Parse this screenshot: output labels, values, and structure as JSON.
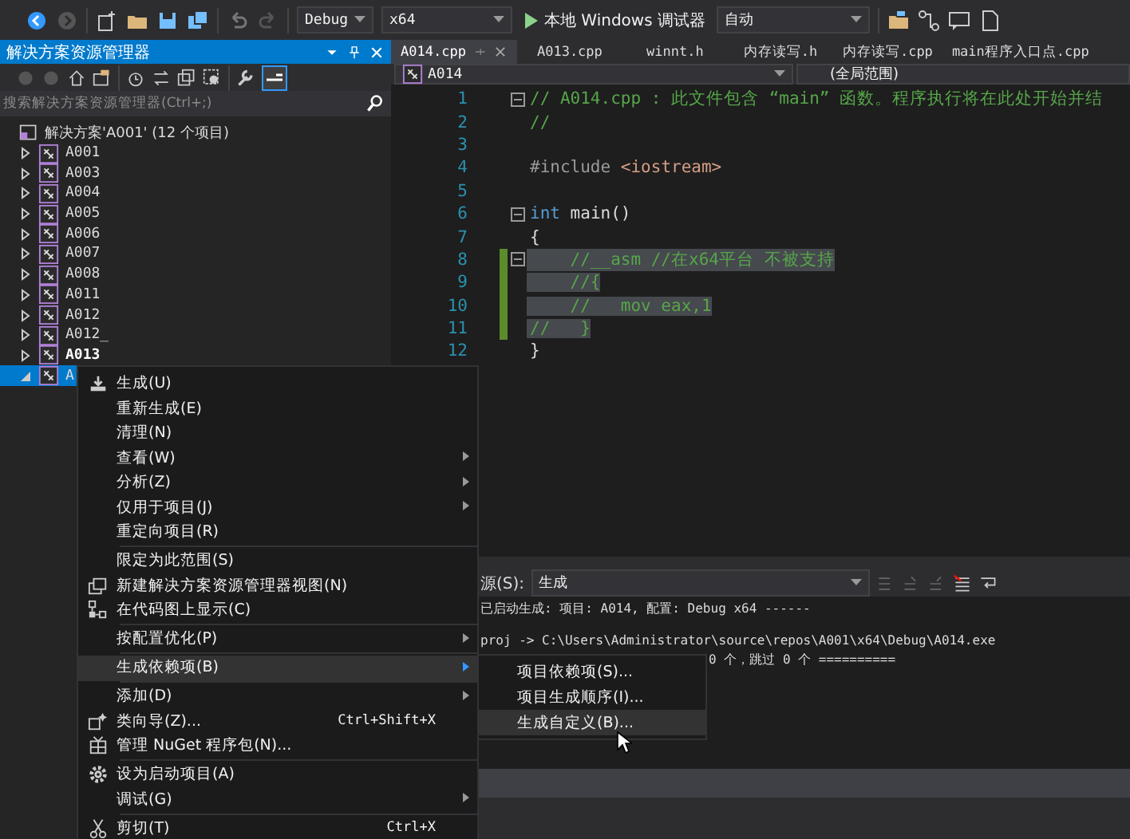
{
  "toolbar": {
    "configuration": "Debug",
    "platform": "x64",
    "debugger": "本地 Windows 调试器",
    "target": "自动"
  },
  "solution_explorer": {
    "title": "解决方案资源管理器",
    "search": {
      "placeholder": "搜索解决方案资源管理器(Ctrl+;)"
    },
    "root": "解决方案'A001' (12 个项目)",
    "projects": [
      {
        "label": "A001",
        "expanded": false,
        "selected": false,
        "startup": false
      },
      {
        "label": "A003",
        "expanded": false,
        "selected": false,
        "startup": false
      },
      {
        "label": "A004",
        "expanded": false,
        "selected": false,
        "startup": false
      },
      {
        "label": "A005",
        "expanded": false,
        "selected": false,
        "startup": false
      },
      {
        "label": "A006",
        "expanded": false,
        "selected": false,
        "startup": false
      },
      {
        "label": "A007",
        "expanded": false,
        "selected": false,
        "startup": false
      },
      {
        "label": "A008",
        "expanded": false,
        "selected": false,
        "startup": false
      },
      {
        "label": "A011",
        "expanded": false,
        "selected": false,
        "startup": false
      },
      {
        "label": "A012",
        "expanded": false,
        "selected": false,
        "startup": false
      },
      {
        "label": "A012_",
        "expanded": false,
        "selected": false,
        "startup": false
      },
      {
        "label": "A013",
        "expanded": false,
        "selected": false,
        "startup": true
      },
      {
        "label": "A",
        "expanded": true,
        "selected": true,
        "startup": false
      }
    ]
  },
  "editor": {
    "tabs": [
      {
        "label": "A014.cpp",
        "selected": true
      },
      {
        "label": "A013.cpp",
        "selected": false
      },
      {
        "label": "winnt.h",
        "selected": false
      },
      {
        "label": "内存读写.h",
        "selected": false
      },
      {
        "label": "内存读写.cpp",
        "selected": false
      },
      {
        "label": "main程序入口点.cpp",
        "selected": false
      }
    ],
    "project": "A014",
    "scope": "(全局范围)",
    "lines": [
      {
        "number": "1",
        "fold": true,
        "changed": false,
        "selected": false,
        "segments": [
          {
            "kind": "comment",
            "text": "// A014.cpp : 此文件包含 “main” 函数。程序执行将在此处开始并结"
          }
        ]
      },
      {
        "number": "2",
        "fold": false,
        "changed": false,
        "selected": false,
        "segments": [
          {
            "kind": "comment",
            "text": "//"
          }
        ]
      },
      {
        "number": "3",
        "fold": false,
        "changed": false
      },
      {
        "number": "4",
        "fold": false,
        "changed": false,
        "selected": false,
        "segments": [
          {
            "kind": "preprocessor",
            "text": "#include"
          },
          {
            "kind": "include",
            "text": "<iostream>"
          }
        ]
      },
      {
        "number": "5",
        "fold": false,
        "changed": false
      },
      {
        "number": "6",
        "fold": true,
        "changed": false,
        "selected": false,
        "segments": [
          {
            "kind": "keyword",
            "text": "int"
          },
          {
            "kind": "plain",
            "text": "main()"
          }
        ]
      },
      {
        "number": "7",
        "fold": false,
        "changed": false,
        "selected": false,
        "segments": [
          {
            "kind": "plain",
            "text": "{"
          }
        ]
      },
      {
        "number": "8",
        "fold": true,
        "changed": true,
        "selected": true,
        "segments": [
          {
            "kind": "comment",
            "text": "    //__asm //在x64平台 不被支持"
          }
        ]
      },
      {
        "number": "9",
        "fold": false,
        "changed": true,
        "selected": true,
        "segments": [
          {
            "kind": "comment",
            "text": "    //{"
          }
        ]
      },
      {
        "number": "10",
        "fold": false,
        "changed": true,
        "selected": true,
        "segments": [
          {
            "kind": "comment",
            "text": "    //   mov eax,1"
          }
        ]
      },
      {
        "number": "11",
        "fold": false,
        "changed": true,
        "selected": true,
        "segments": [
          {
            "kind": "comment",
            "text": "//   }"
          }
        ]
      },
      {
        "number": "12",
        "fold": false,
        "changed": false,
        "selected": false,
        "segments": [
          {
            "kind": "plain",
            "text": "}"
          }
        ]
      }
    ]
  },
  "output": {
    "source_label": "源(S):",
    "source": "生成",
    "lines": [
      {
        "kind": "status",
        "text": "已启动生成: 项目: A014, 配置: Debug x64 ------"
      },
      {
        "kind": "path",
        "text": "proj -> C:\\Users\\Administrator\\source\\repos\\A001\\x64\\Debug\\A014.exe"
      },
      {
        "kind": "summary",
        "text": "0 个，跳过 0 个 =========="
      }
    ]
  },
  "context_menu": {
    "items": [
      {
        "kind": "build",
        "label": "生成(U)",
        "submenu": false,
        "selected": false
      },
      {
        "kind": "plain",
        "label": "重新生成(E)",
        "submenu": false,
        "selected": false
      },
      {
        "kind": "plain",
        "label": "清理(N)",
        "submenu": false,
        "selected": false
      },
      {
        "kind": "plain",
        "label": "查看(W)",
        "submenu": true,
        "selected": false
      },
      {
        "kind": "plain",
        "label": "分析(Z)",
        "submenu": true,
        "selected": false
      },
      {
        "kind": "plain",
        "label": "仅用于项目(J)",
        "submenu": true,
        "selected": false
      },
      {
        "kind": "plain",
        "label": "重定向项目(R)",
        "submenu": false,
        "selected": false
      },
      {
        "kind": "separator"
      },
      {
        "kind": "plain",
        "label": "限定为此范围(S)",
        "submenu": false,
        "selected": false
      },
      {
        "kind": "new-view",
        "label": "新建解决方案资源管理器视图(N)",
        "submenu": false,
        "selected": false
      },
      {
        "kind": "code-map",
        "label": "在代码图上显示(C)",
        "submenu": false,
        "selected": false
      },
      {
        "kind": "separator"
      },
      {
        "kind": "plain",
        "label": "按配置优化(P)",
        "submenu": true,
        "selected": false
      },
      {
        "kind": "separator"
      },
      {
        "kind": "plain",
        "label": "生成依赖项(B)",
        "submenu": true,
        "selected": true
      },
      {
        "kind": "separator"
      },
      {
        "kind": "plain",
        "label": "添加(D)",
        "submenu": true,
        "selected": false
      },
      {
        "kind": "class-wizard",
        "label": "类向导(Z)...",
        "shortcut": "Ctrl+Shift+X",
        "submenu": false,
        "selected": false
      },
      {
        "kind": "nuget",
        "label": "管理 NuGet 程序包(N)...",
        "submenu": false,
        "selected": false
      },
      {
        "kind": "separator"
      },
      {
        "kind": "gear",
        "label": "设为启动项目(A)",
        "submenu": false,
        "selected": false
      },
      {
        "kind": "plain",
        "label": "调试(G)",
        "submenu": true,
        "selected": false
      },
      {
        "kind": "separator"
      },
      {
        "kind": "cut",
        "label": "剪切(T)",
        "shortcut": "Ctrl+X",
        "submenu": false,
        "selected": false
      }
    ]
  },
  "submenu": {
    "items": [
      {
        "label": "项目依赖项(S)...",
        "selected": false
      },
      {
        "label": "项目生成顺序(I)...",
        "selected": false
      },
      {
        "label": "生成自定义(B)...",
        "selected": true
      }
    ]
  }
}
